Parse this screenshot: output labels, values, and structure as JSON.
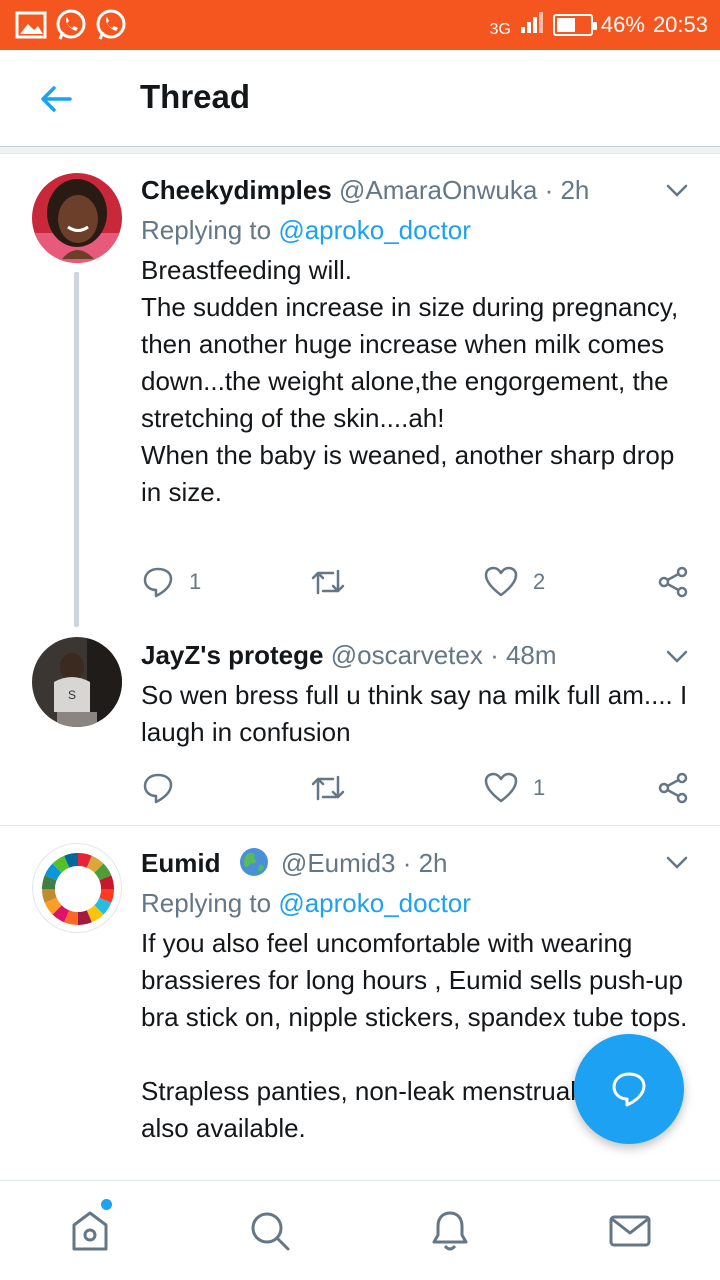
{
  "status_bar": {
    "network": "3G",
    "battery_percent": 46,
    "battery_text": "46%",
    "time": "20:53",
    "notification_icons": [
      "image-icon",
      "whatsapp-icon",
      "whatsapp-icon"
    ]
  },
  "header": {
    "title": "Thread",
    "back_icon": "arrow-left-icon"
  },
  "tweets": [
    {
      "display_name": "Cheekydimples",
      "handle": "@AmaraOnwuka",
      "time": "· 2h",
      "replying_prefix": "Replying to",
      "replying_to": "@aproko_doctor",
      "body": "Breastfeeding will.\nThe sudden increase in size during pregnancy, then another huge increase when milk comes down...the weight alone,the engorgement, the stretching of the skin....ah!\nWhen the baby is weaned, another sharp drop in size.",
      "replies": "1",
      "retweets": "",
      "likes": "2"
    },
    {
      "display_name": "JayZ's protege",
      "handle": "@oscarvetex",
      "time": "· 48m",
      "body": "So wen bress full u think say na milk full am.... I laugh in confusion",
      "replies": "",
      "retweets": "",
      "likes": "1"
    },
    {
      "display_name": "Eumid",
      "handle": "@Eumid3",
      "time": "· 2h",
      "replying_prefix": "Replying to",
      "replying_to": "@aproko_doctor",
      "body": "If you also feel uncomfortable with wearing brassieres for long hours , Eumid sells push-up bra stick on, nipple stickers, spandex tube tops.\n\nStrapless panties, non-leak menstrual panties also available."
    }
  ],
  "fab": {
    "icon": "compose-reply-icon"
  },
  "bottom_nav": [
    "home-icon",
    "search-icon",
    "notifications-icon",
    "messages-icon"
  ],
  "colors": {
    "status_bar": "#f5551f",
    "accent": "#1da1f2",
    "text": "#14171a",
    "muted": "#657786"
  }
}
